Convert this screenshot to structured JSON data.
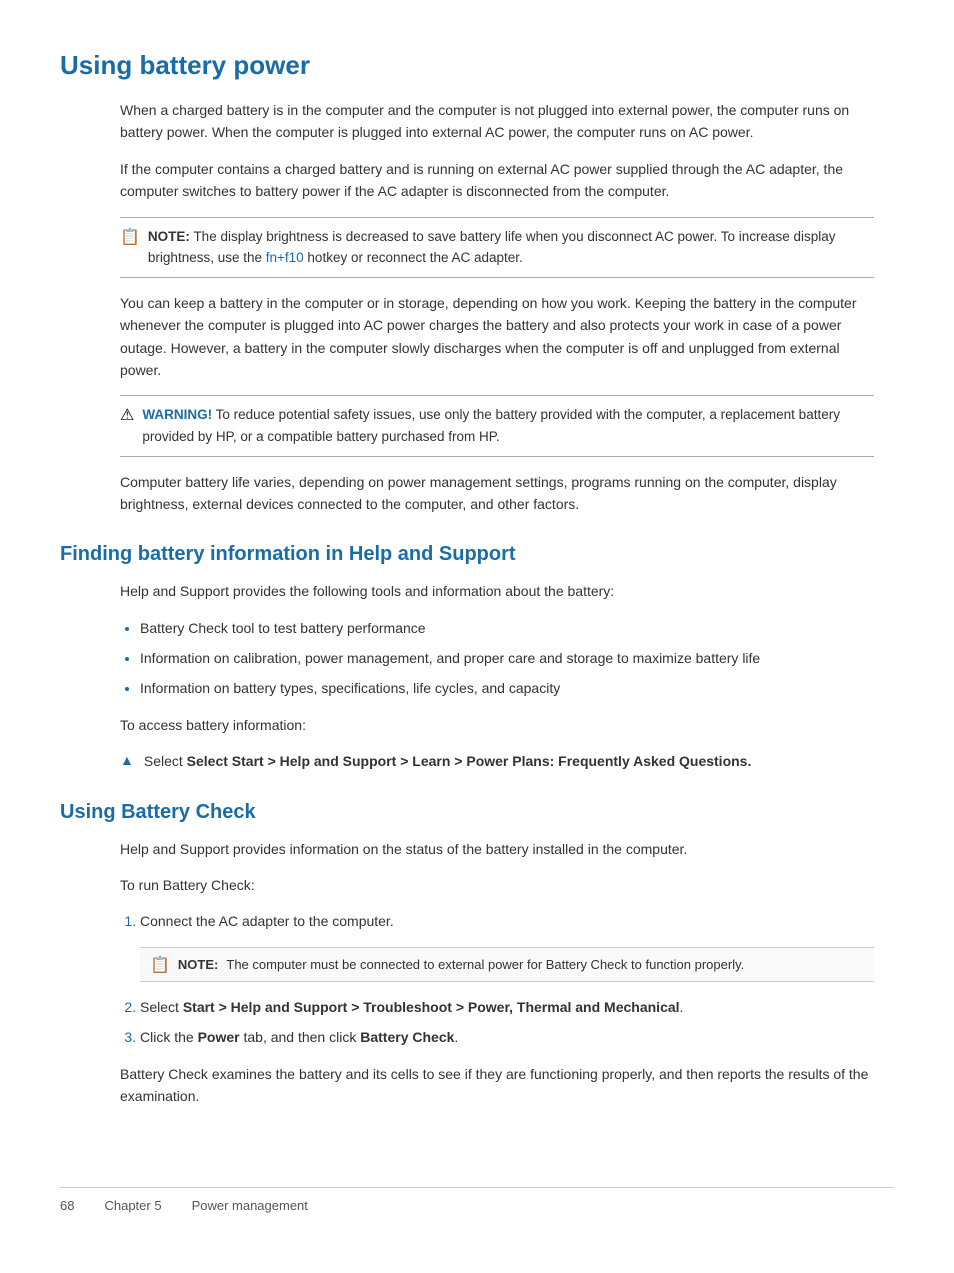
{
  "page": {
    "title": "Using battery power",
    "sections": [
      {
        "id": "using-battery-power",
        "paragraphs": [
          "When a charged battery is in the computer and the computer is not plugged into external power, the computer runs on battery power. When the computer is plugged into external AC power, the computer runs on AC power.",
          "If the computer contains a charged battery and is running on external AC power supplied through the AC adapter, the computer switches to battery power if the AC adapter is disconnected from the computer."
        ],
        "note": {
          "label": "NOTE:",
          "text_before": "The display brightness is decreased to save battery life when you disconnect AC power. To increase display brightness, use the ",
          "link_text": "fn+f10",
          "text_after": " hotkey or reconnect the AC adapter."
        },
        "paragraphs2": [
          "You can keep a battery in the computer or in storage, depending on how you work. Keeping the battery in the computer whenever the computer is plugged into AC power charges the battery and also protects your work in case of a power outage. However, a battery in the computer slowly discharges when the computer is off and unplugged from external power."
        ],
        "warning": {
          "label": "WARNING!",
          "text": "To reduce potential safety issues, use only the battery provided with the computer, a replacement battery provided by HP, or a compatible battery purchased from HP."
        },
        "paragraphs3": [
          "Computer battery life varies, depending on power management settings, programs running on the computer, display brightness, external devices connected to the computer, and other factors."
        ]
      },
      {
        "id": "finding-battery-info",
        "title": "Finding battery information in Help and Support",
        "intro": "Help and Support provides the following tools and information about the battery:",
        "bullets": [
          "Battery Check tool to test battery performance",
          "Information on calibration, power management, and proper care and storage to maximize battery life",
          "Information on battery types, specifications, life cycles, and capacity"
        ],
        "access_label": "To access battery information:",
        "arrow_item": "Select Start > Help and Support > Learn > Power Plans: Frequently Asked Questions."
      },
      {
        "id": "using-battery-check",
        "title": "Using Battery Check",
        "intro": "Help and Support provides information on the status of the battery installed in the computer.",
        "run_label": "To run Battery Check:",
        "steps": [
          {
            "num": "1.",
            "text": "Connect the AC adapter to the computer."
          },
          {
            "num": "2.",
            "text_before": "Select ",
            "bold_text": "Start > Help and Support > Troubleshoot > Power, Thermal and Mechanical",
            "text_after": "."
          },
          {
            "num": "3.",
            "text_before": "Click the ",
            "bold1": "Power",
            "text_mid": " tab, and then click ",
            "bold2": "Battery Check",
            "text_after": "."
          }
        ],
        "note_inline": "The computer must be connected to external power for Battery Check to function properly.",
        "closing": "Battery Check examines the battery and its cells to see if they are functioning properly, and then reports the results of the examination."
      }
    ],
    "footer": {
      "page_number": "68",
      "chapter": "Chapter 5",
      "chapter_title": "Power management"
    }
  }
}
